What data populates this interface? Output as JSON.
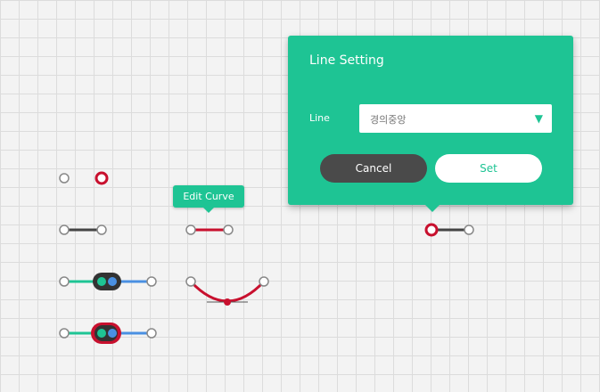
{
  "tooltip": {
    "text": "Edit Curve"
  },
  "dialog": {
    "title": "Line Setting",
    "field_label": "Line",
    "select_value": "경의중앙",
    "cancel_label": "Cancel",
    "set_label": "Set"
  },
  "colors": {
    "accent": "#1ec494",
    "selected_red": "#c8102e",
    "line_dark": "#444444",
    "line_teal": "#1ec494",
    "line_blue": "#4a90e2"
  },
  "icons": {
    "dropdown_arrow": "▼"
  }
}
